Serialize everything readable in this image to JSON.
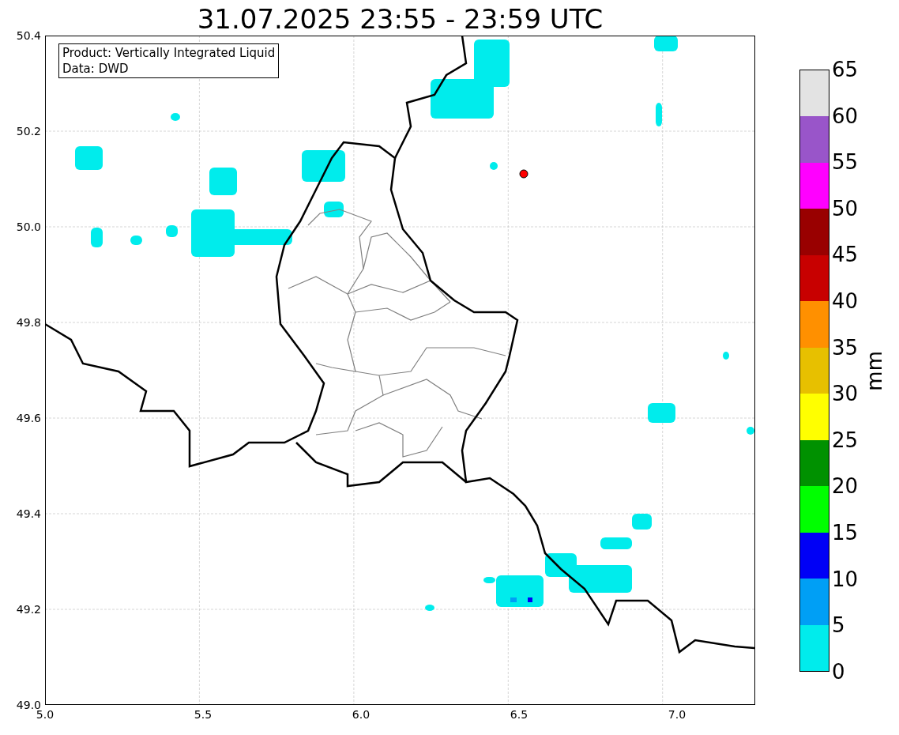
{
  "title": "31.07.2025 23:55 - 23:59 UTC",
  "legend": [
    "Product: Vertically Integrated Liquid",
    "Data: DWD"
  ],
  "map": {
    "x_ticks": [
      "5.0",
      "5.5",
      "6.0",
      "6.5",
      "7.0"
    ],
    "y_ticks": [
      "50.4",
      "50.2",
      "50.0",
      "49.8",
      "49.6",
      "49.4",
      "49.2",
      "49.0"
    ]
  },
  "colorbar": {
    "label": "mm",
    "segments": [
      {
        "color": "#e3e3e3"
      },
      {
        "color": "#9955c9"
      },
      {
        "color": "#ff00ff"
      },
      {
        "color": "#990000"
      },
      {
        "color": "#c80000"
      },
      {
        "color": "#ff9000"
      },
      {
        "color": "#e7c000"
      },
      {
        "color": "#ffff00"
      },
      {
        "color": "#009100"
      },
      {
        "color": "#00ff00"
      },
      {
        "color": "#0000f6"
      },
      {
        "color": "#009ff5"
      },
      {
        "color": "#00ecec"
      }
    ],
    "ticks": [
      "65",
      "60",
      "55",
      "50",
      "45",
      "40",
      "35",
      "30",
      "25",
      "20",
      "15",
      "10",
      "5",
      "0"
    ]
  }
}
